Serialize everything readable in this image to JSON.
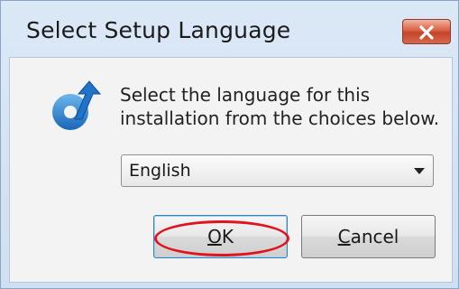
{
  "window": {
    "title": "Select Setup Language"
  },
  "titlebar": {
    "close_icon": "close-icon"
  },
  "dialog": {
    "icon": "setup-arrow-icon",
    "prompt_line1": "Select the language for this",
    "prompt_line2": "installation from the choices below.",
    "language_select": {
      "selected": "English"
    },
    "ok_button": {
      "accel": "O",
      "rest": "K"
    },
    "cancel_button": {
      "accel": "C",
      "rest": "ancel"
    }
  },
  "annotation": {
    "highlight_color": "#e0141e",
    "highlight_target": "ok-button"
  },
  "colors": {
    "close_button": "#c4442a",
    "focus_border": "#3c7fb1"
  }
}
